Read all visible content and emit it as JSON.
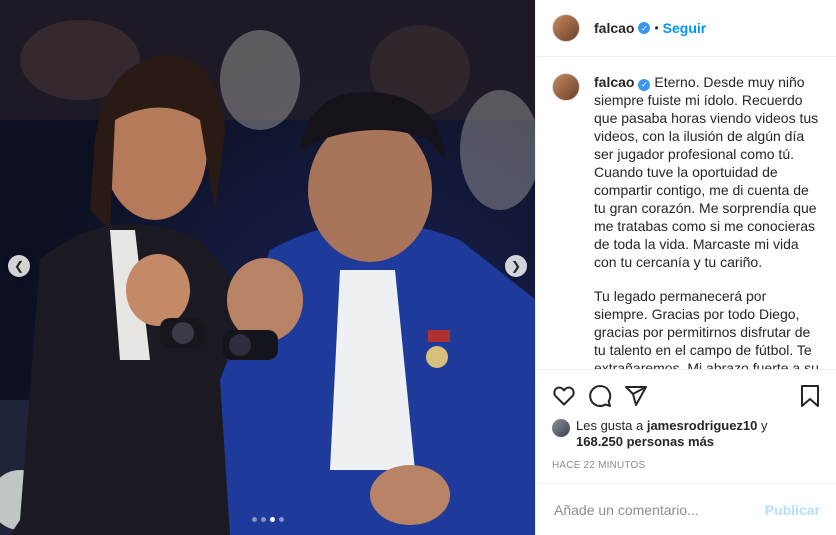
{
  "user": {
    "username": "falcao",
    "follow_label": "Seguir",
    "separator": "•"
  },
  "caption": {
    "username": "falcao",
    "paragraph1": "Eterno. Desde muy niño siempre fuiste mi ídolo. Recuerdo que pasaba horas viendo videos tus videos, con la ilusión de algún día ser jugador profesional como tú. Cuando tuve la oportuidad de compartir contigo, me di cuenta de tu gran corazón. Me sorprendía que me tratabas como si me conocieras de toda la vida. Marcaste mi vida con tu cercanía y tu cariño.",
    "paragraph2": "Tu legado permanecerá por siempre. Gracias por todo Diego, gracias por permitirnos disfrutar de tu talento en el campo de fútbol. Te extrañaremos. Mi abrazo fuerte a su familia y a todo el pueblo argentino en estos momentos"
  },
  "likes": {
    "prefix": "Les gusta a",
    "user": "jamesrodriguez10",
    "conjunction": "y",
    "count": "168.250 personas más"
  },
  "timestamp": "HACE 22 MINUTOS",
  "comment": {
    "placeholder": "Añade un comentario...",
    "publish_label": "Publicar"
  },
  "carousel": {
    "total": 4,
    "active": 3
  },
  "colors": {
    "link": "#0095f6",
    "verified": "#3897f0",
    "publish_disabled": "#b2dffc"
  },
  "icons": [
    "heart-icon",
    "comment-icon",
    "share-icon",
    "bookmark-icon",
    "chevron-left-icon",
    "chevron-right-icon",
    "verified-badge-icon"
  ]
}
